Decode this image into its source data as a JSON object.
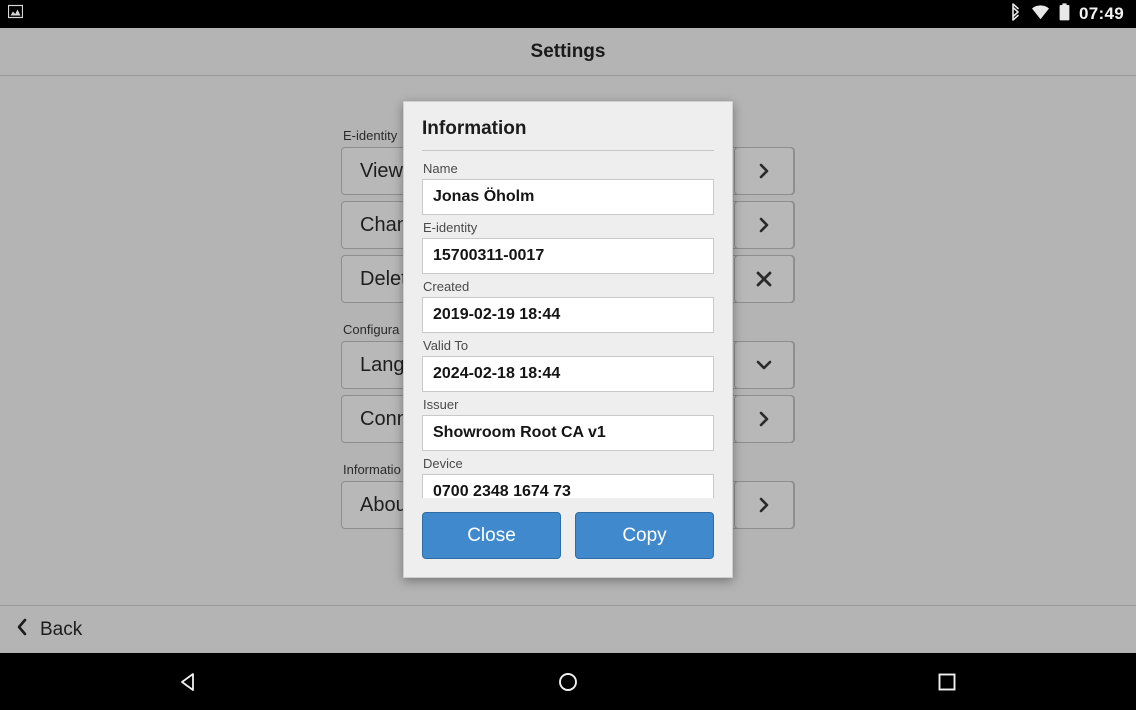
{
  "statusbar": {
    "left_icon": "screenshot-image-icon",
    "icons": [
      "bluetooth-icon",
      "wifi-icon",
      "battery-icon"
    ],
    "time": "07:49"
  },
  "header": {
    "title": "Settings"
  },
  "settings": {
    "sections": [
      {
        "label": "E-identity",
        "rows": [
          {
            "label": "View",
            "action_icon": "chevron-right-icon"
          },
          {
            "label": "Chan",
            "action_icon": "chevron-right-icon"
          },
          {
            "label": "Delet",
            "action_icon": "close-x-icon"
          }
        ]
      },
      {
        "label": "Configura",
        "rows": [
          {
            "label": "Lang",
            "action_icon": "chevron-down-icon"
          },
          {
            "label": "Conn",
            "action_icon": "chevron-right-icon"
          }
        ]
      },
      {
        "label": "Informatio",
        "rows": [
          {
            "label": "Abou",
            "action_icon": "chevron-right-icon"
          }
        ]
      }
    ]
  },
  "dialog": {
    "title": "Information",
    "fields": [
      {
        "label": "Name",
        "value": "Jonas Öholm"
      },
      {
        "label": "E-identity",
        "value": "15700311-0017"
      },
      {
        "label": "Created",
        "value": "2019-02-19 18:44"
      },
      {
        "label": "Valid To",
        "value": "2024-02-18 18:44"
      },
      {
        "label": "Issuer",
        "value": "Showroom Root CA v1"
      },
      {
        "label": "Device",
        "value": "0700 2348 1674 73"
      }
    ],
    "buttons": {
      "close": "Close",
      "copy": "Copy"
    },
    "accent_color": "#4189cd"
  },
  "footer": {
    "back_label": "Back",
    "back_icon": "chevron-left-icon"
  },
  "navbar": {
    "back": "nav-back-triangle-icon",
    "home": "nav-home-circle-icon",
    "recents": "nav-recents-square-icon"
  }
}
